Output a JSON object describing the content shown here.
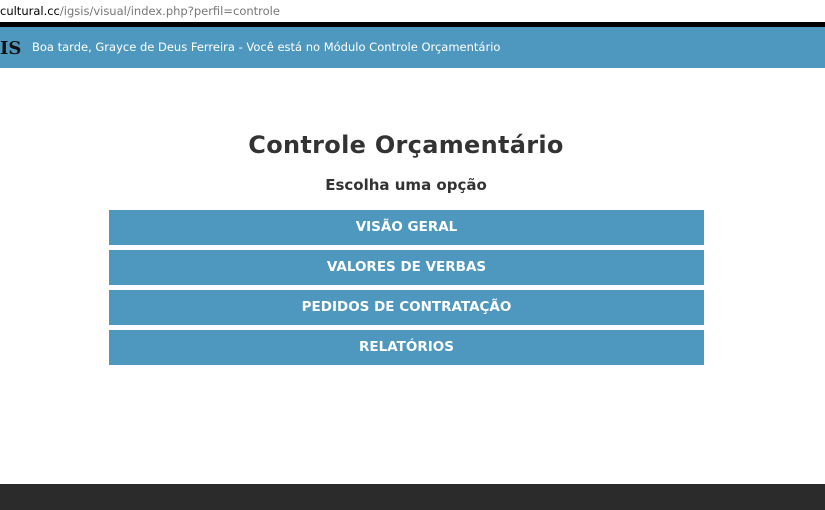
{
  "browser": {
    "url_domain": "cultural.cc",
    "url_path": "/igsis/visual/index.php?perfil=controle"
  },
  "header": {
    "logo_text": "IS",
    "greeting": "Boa tarde, Grayce de Deus Ferreira - Você está no Módulo Controle Orçamentário"
  },
  "main": {
    "title": "Controle Orçamentário",
    "subtitle": "Escolha uma opção",
    "menu": [
      {
        "label": "VISÃO GERAL"
      },
      {
        "label": "VALORES DE VERBAS"
      },
      {
        "label": "PEDIDOS DE CONTRATAÇÃO"
      },
      {
        "label": "RELATÓRIOS"
      }
    ]
  },
  "colors": {
    "accent": "#4e98bf",
    "footer": "#2b2b2b",
    "text": "#333333"
  }
}
